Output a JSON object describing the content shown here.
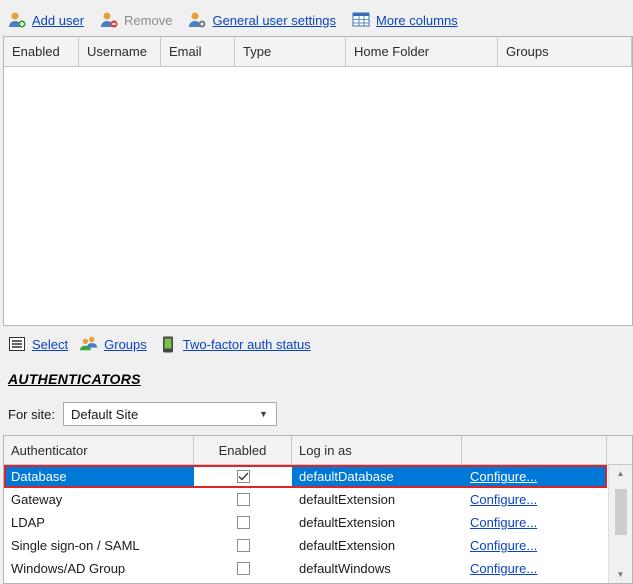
{
  "toolbar": {
    "add_user": "Add user",
    "remove": "Remove",
    "general_settings": "General user settings",
    "more_columns": "More columns"
  },
  "users_grid": {
    "columns": [
      "Enabled",
      "Username",
      "Email",
      "Type",
      "Home Folder",
      "Groups"
    ]
  },
  "bottom_toolbar": {
    "select": "Select",
    "groups": "Groups",
    "two_factor": "Two-factor auth status"
  },
  "authenticators": {
    "title": "AUTHENTICATORS",
    "site_label": "For site:",
    "site_value": "Default Site",
    "columns": [
      "Authenticator",
      "Enabled",
      "Log in as"
    ],
    "rows": [
      {
        "name": "Database",
        "enabled": true,
        "login_as": "defaultDatabase",
        "action": "Configure..."
      },
      {
        "name": "Gateway",
        "enabled": false,
        "login_as": "defaultExtension",
        "action": "Configure..."
      },
      {
        "name": "LDAP",
        "enabled": false,
        "login_as": "defaultExtension",
        "action": "Configure..."
      },
      {
        "name": "Single sign-on / SAML",
        "enabled": false,
        "login_as": "defaultExtension",
        "action": "Configure..."
      },
      {
        "name": "Windows/AD Group",
        "enabled": false,
        "login_as": "defaultWindows",
        "action": "Configure..."
      }
    ]
  },
  "colors": {
    "link": "#0a44c4",
    "selection": "#0078d7",
    "highlight_border": "#d9262c"
  }
}
